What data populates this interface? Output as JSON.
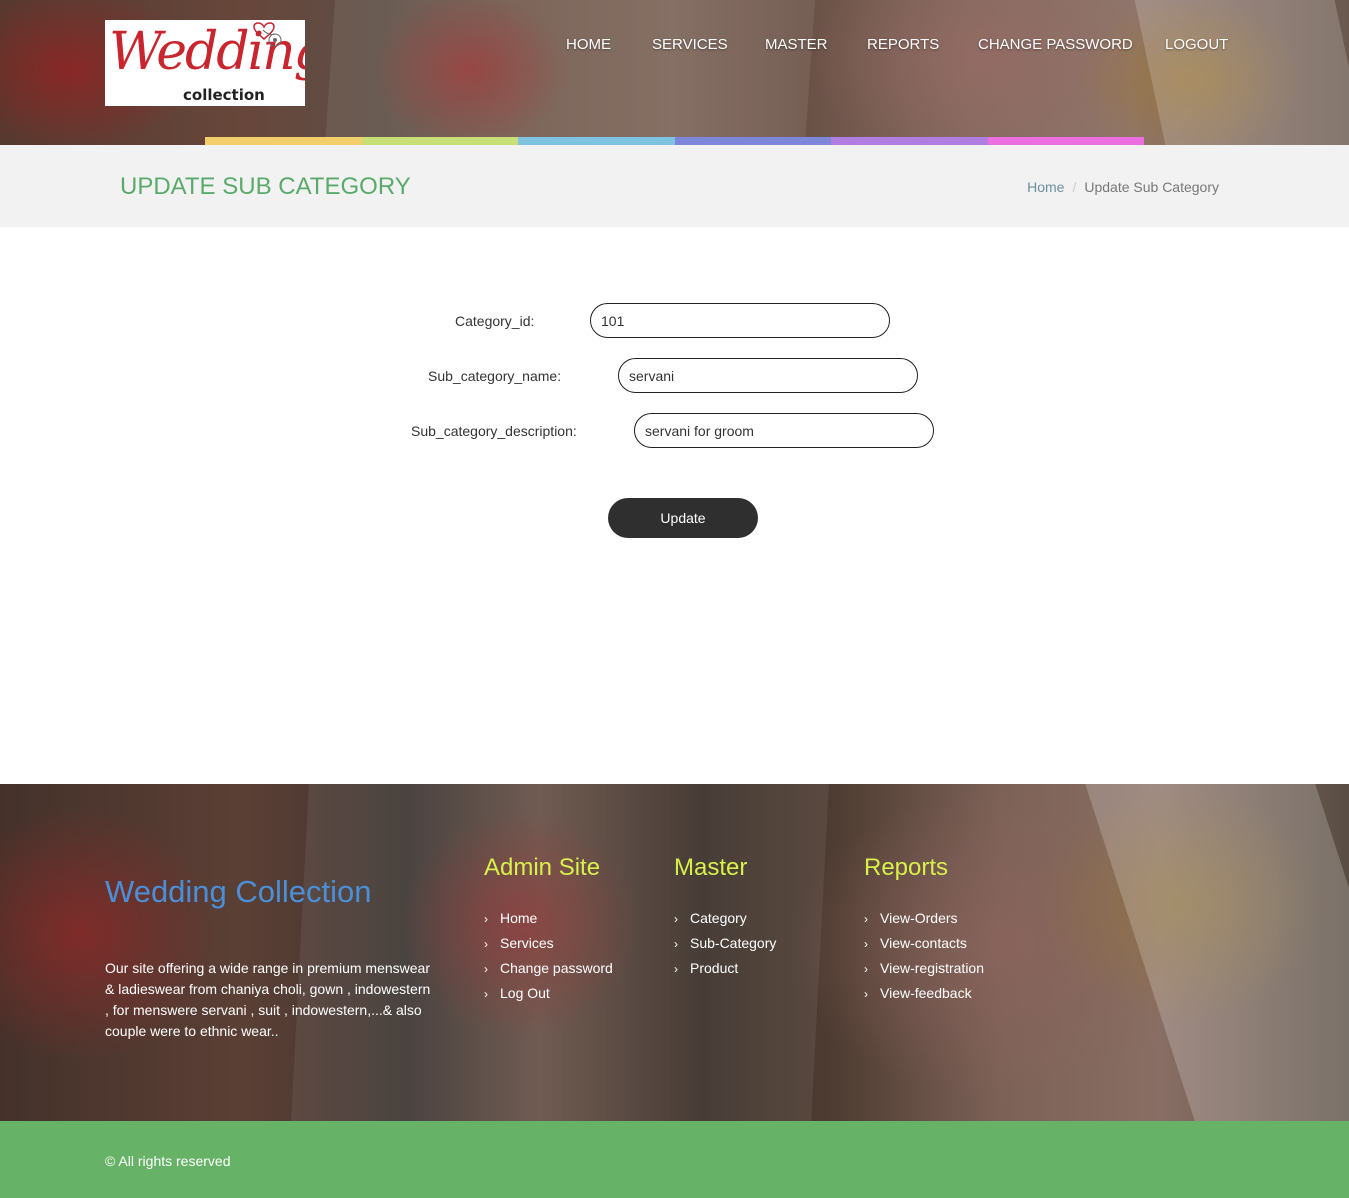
{
  "brand": {
    "logo_script": "Wedding",
    "logo_sub": "collection"
  },
  "nav": {
    "home": "HOME",
    "services": "SERVICES",
    "master": "MASTER",
    "reports": "REPORTS",
    "change_password": "CHANGE PASSWORD",
    "logout": "LOGOUT"
  },
  "colors": {
    "colorbar": [
      "#f2cf6a",
      "#c8df78",
      "#7ec4e2",
      "#7d86d8",
      "#b07ee0",
      "#ec6ee0"
    ],
    "accent_green": "#5aab6b",
    "footer_heading": "#d8f04a",
    "footer_brand": "#4a8fd8",
    "copyright_bar": "#66b266"
  },
  "page": {
    "title": "UPDATE SUB CATEGORY",
    "breadcrumb_home": "Home",
    "breadcrumb_sep": "/",
    "breadcrumb_current": "Update Sub Category"
  },
  "form": {
    "category_id_label": "Category_id:",
    "category_id_value": "101",
    "sub_category_name_label": "Sub_category_name:",
    "sub_category_name_value": "servani",
    "sub_category_description_label": "Sub_category_description:",
    "sub_category_description_value": "servani for groom",
    "update_label": "Update"
  },
  "footer": {
    "brand": "Wedding Collection",
    "description": "Our site offering a wide range in premium menswear & ladieswear from chaniya choli, gown , indowestern , for menswere servani , suit , indowestern,...& also couple were to ethnic wear..",
    "admin_heading": "Admin Site",
    "admin_links": [
      "Home",
      "Services",
      "Change password",
      "Log Out"
    ],
    "master_heading": "Master",
    "master_links": [
      "Category",
      "Sub-Category",
      "Product"
    ],
    "reports_heading": "Reports",
    "reports_links": [
      "View-Orders",
      "View-contacts",
      "View-registration",
      "View-feedback"
    ],
    "copyright": "© All rights reserved"
  },
  "icons": {
    "list_bullet": "chevron-right-icon"
  }
}
